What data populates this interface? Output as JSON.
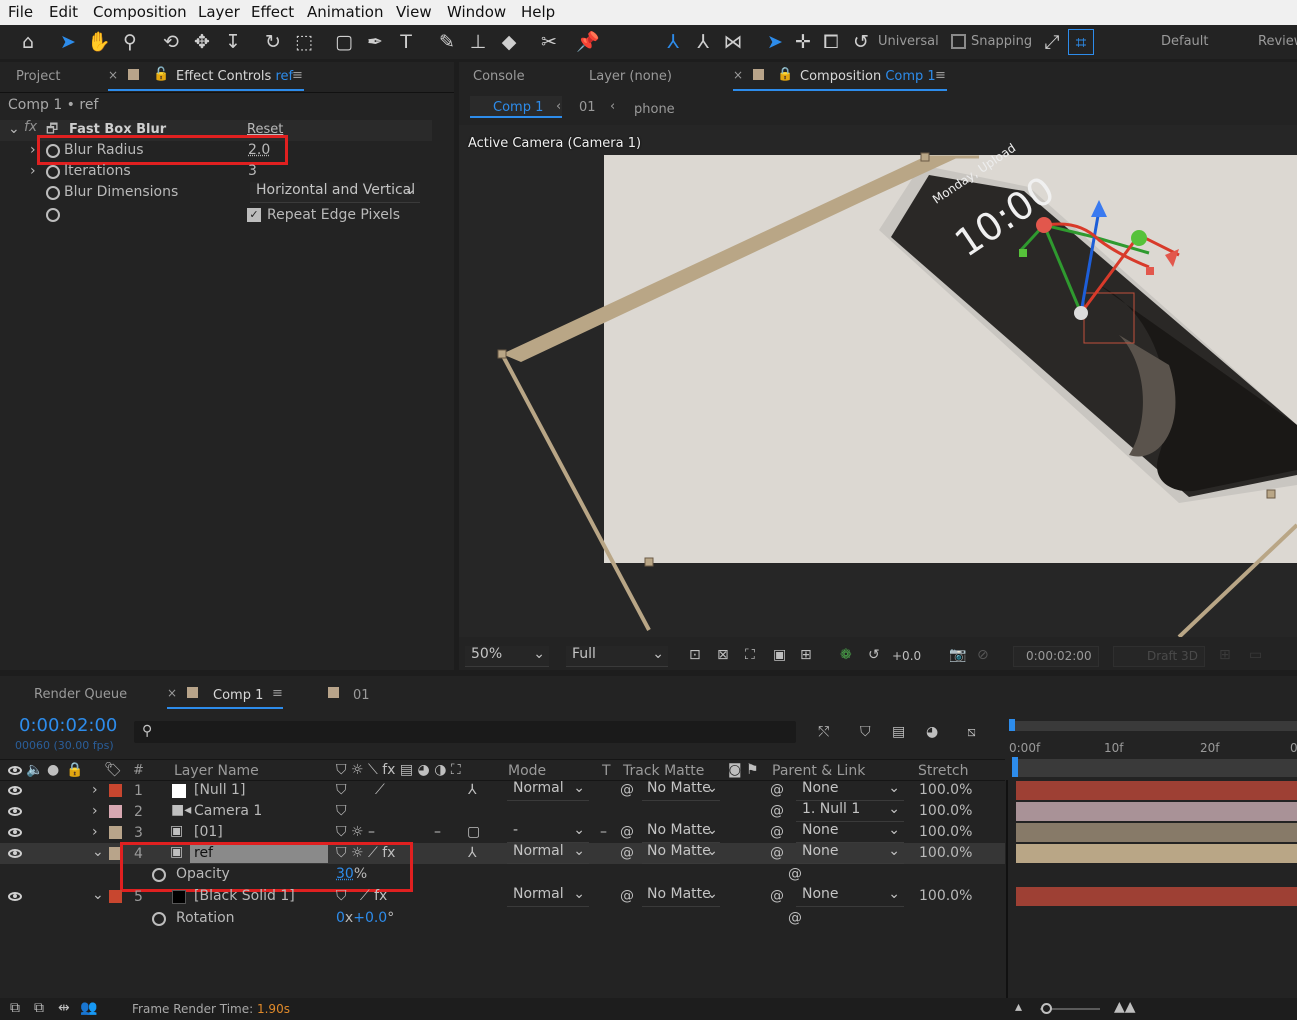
{
  "menu": [
    "File",
    "Edit",
    "Composition",
    "Layer",
    "Effect",
    "Animation",
    "View",
    "Window",
    "Help"
  ],
  "toolbar": {
    "axis_mode": "Universal",
    "snapping": "Snapping",
    "workspace": "Default",
    "review": "Review"
  },
  "left_panel": {
    "tab_project": "Project",
    "tab_effect_controls": "Effect Controls",
    "tab_effect_target": "ref",
    "breadcrumb": "Comp 1 • ref",
    "effect_name": "Fast Box Blur",
    "reset": "Reset",
    "props": [
      {
        "name": "Blur Radius",
        "value": "2.0"
      },
      {
        "name": "Iterations",
        "value": "3"
      },
      {
        "name": "Blur Dimensions",
        "value": "Horizontal and Vertical"
      }
    ],
    "repeat_edge": "Repeat Edge Pixels"
  },
  "comp_panel": {
    "tab_console": "Console",
    "tab_layer": "Layer (none)",
    "tab_composition": "Composition",
    "tab_comp_name": "Comp 1",
    "crumbs": [
      "Comp 1",
      "01",
      "phone"
    ],
    "camera_label": "Active Camera (Camera 1)",
    "phone_date": "Monday, Upload",
    "phone_time": "10:00",
    "zoom": "50%",
    "resolution": "Full",
    "exposure": "+0.0",
    "timecode": "0:00:02:00",
    "draft": "Draft 3D"
  },
  "timeline": {
    "tab_render_queue": "Render Queue",
    "tab_comp": "Comp 1",
    "tab_other": "01",
    "current_time": "0:00:02:00",
    "frame_info": "00060 (30.00 fps)",
    "col_hash": "#",
    "col_layer_name": "Layer Name",
    "col_mode": "Mode",
    "col_t": "T",
    "col_track_matte": "Track Matte",
    "col_parent": "Parent & Link",
    "col_stretch": "Stretch",
    "ruler": [
      "0:00f",
      "10f",
      "20f",
      "0"
    ],
    "layers": [
      {
        "num": "1",
        "name": "[Null 1]",
        "mode": "Normal",
        "matte": "No Matte",
        "parent": "None",
        "stretch": "100.0%",
        "color": "#c8462f"
      },
      {
        "num": "2",
        "name": "Camera 1",
        "mode": "",
        "matte": "",
        "parent": "1. Null 1",
        "stretch": "100.0%",
        "color": "#d8a8b2"
      },
      {
        "num": "3",
        "name": "[01]",
        "mode": "-",
        "matte": "No Matte",
        "parent": "None",
        "stretch": "100.0%",
        "color": "#b8a48a"
      },
      {
        "num": "4",
        "name": "ref",
        "mode": "Normal",
        "matte": "No Matte",
        "parent": "None",
        "stretch": "100.0%",
        "color": "#b8a48a"
      },
      {
        "num": "5",
        "name": "[Black Solid 1]",
        "mode": "Normal",
        "matte": "No Matte",
        "parent": "None",
        "stretch": "100.0%",
        "color": "#c8462f"
      }
    ],
    "opacity_label": "Opacity",
    "opacity_value": "30",
    "opacity_unit": "%",
    "rotation_label": "Rotation",
    "rotation_turns": "0",
    "rotation_sep": "x",
    "rotation_deg": "+0.0",
    "rotation_unit": "°"
  },
  "status": {
    "render_label": "Frame Render Time:",
    "render_value": "1.90s"
  }
}
